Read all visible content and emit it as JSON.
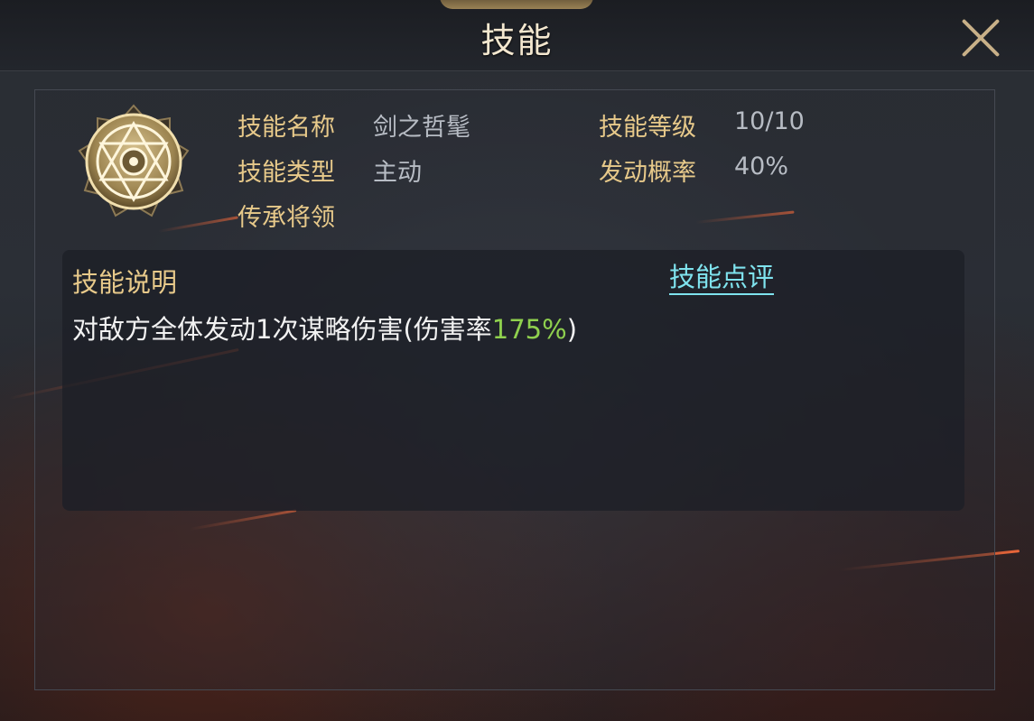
{
  "window": {
    "title": "技能"
  },
  "skill": {
    "icon": "golden-hexagram-skill-emblem-icon",
    "name_label": "技能名称",
    "name_value": "剑之哲髦",
    "level_label": "技能等级",
    "level_value": "10/10",
    "type_label": "技能类型",
    "type_value": "主动",
    "chance_label": "发动概率",
    "chance_value": "40%",
    "inherit_label": "传承将领"
  },
  "description": {
    "title": "技能说明",
    "review_link": "技能点评",
    "text_prefix": "对敌方全体发动1次谋略伤害(伤害率",
    "text_highlight": "175%",
    "text_suffix": ")"
  },
  "colors": {
    "label_gold": "#e7c98a",
    "value_gray": "#b7bcc4",
    "link_cyan": "#7fe3ee",
    "highlight_green": "#8fd04e"
  }
}
